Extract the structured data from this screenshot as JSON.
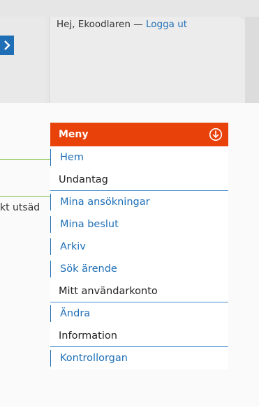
{
  "header": {
    "greeting_prefix": "Hej, Ekoodlaren — ",
    "logout_label": "Logga ut"
  },
  "side": {
    "truncated_text": "kt utsäd"
  },
  "menu": {
    "title": "Meny",
    "items": [
      {
        "label": "Hem",
        "kind": "link"
      },
      {
        "label": "Undantag",
        "kind": "section"
      },
      {
        "label": "Mina ansökningar",
        "kind": "link"
      },
      {
        "label": "Mina beslut",
        "kind": "link"
      },
      {
        "label": "Arkiv",
        "kind": "link"
      },
      {
        "label": "Sök ärende",
        "kind": "link"
      },
      {
        "label": "Mitt användarkonto",
        "kind": "section"
      },
      {
        "label": "Ändra",
        "kind": "link"
      },
      {
        "label": "Information",
        "kind": "section"
      },
      {
        "label": "Kontrollorgan",
        "kind": "link"
      }
    ]
  },
  "colors": {
    "accent": "#e8410a",
    "link": "#1f6fb6",
    "divider_green": "#7bbf3c"
  },
  "icons": {
    "next": "chevron-right-icon",
    "menu_toggle": "circle-arrow-down-icon"
  }
}
